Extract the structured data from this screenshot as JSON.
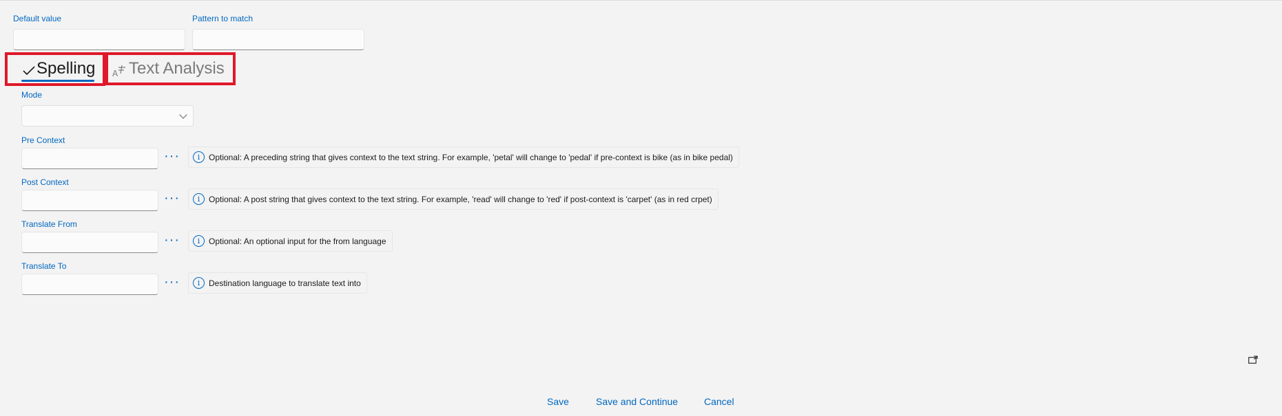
{
  "fields": {
    "default_value": {
      "label": "Default value",
      "value": ""
    },
    "pattern_to_match": {
      "label": "Pattern to match",
      "value": ""
    }
  },
  "tabs": [
    {
      "label": "Spelling",
      "icon": "checkmark-icon",
      "selected": true
    },
    {
      "label": "Text Analysis",
      "icon": "text-analysis-icon",
      "selected": false
    }
  ],
  "spelling": {
    "mode": {
      "label": "Mode",
      "value": ""
    },
    "pre_context": {
      "label": "Pre Context",
      "value": "",
      "more": "···",
      "info": "Optional: A preceding string that gives context to the text string. For example, 'petal' will change to 'pedal' if pre-context is bike (as in bike pedal)"
    },
    "post_context": {
      "label": "Post Context",
      "value": "",
      "more": "···",
      "info": "Optional: A post string that gives context to the text string. For example, 'read' will change to 'red' if post-context is 'carpet' (as in red crpet)"
    },
    "translate_from": {
      "label": "Translate From",
      "value": "",
      "more": "···",
      "info": "Optional: An optional input for the from language"
    },
    "translate_to": {
      "label": "Translate To",
      "value": "",
      "more": "···",
      "info": "Destination language to translate text into"
    }
  },
  "actions": {
    "save": "Save",
    "save_continue": "Save and Continue",
    "cancel": "Cancel"
  },
  "colors": {
    "accent": "#0067c0",
    "highlight": "#e0182a",
    "background": "#f3f3f3"
  }
}
